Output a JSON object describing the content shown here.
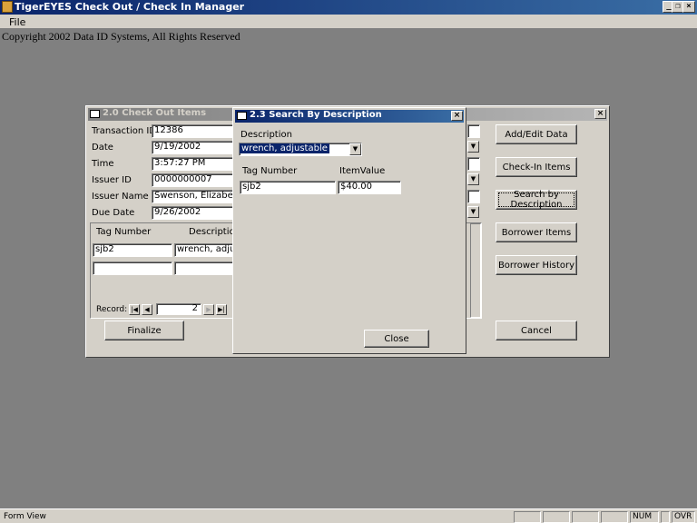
{
  "app": {
    "title": "TigerEYES Check Out / Check In Manager",
    "menu": [
      "File"
    ],
    "copyright": "Copyright 2002 Data ID Systems, All Rights Reserved",
    "window_controls": {
      "minimize": "_",
      "restore": "❐",
      "close": "×"
    }
  },
  "checkout": {
    "title": "2.0  Check Out Items",
    "fields": {
      "transaction_id": {
        "label": "Transaction ID",
        "value": "12386"
      },
      "date": {
        "label": "Date",
        "value": "9/19/2002"
      },
      "time": {
        "label": "Time",
        "value": "3:57:27 PM"
      },
      "issuer_id": {
        "label": "Issuer ID",
        "value": "0000000007"
      },
      "issuer_name": {
        "label": "Issuer Name",
        "value": "Swenson, Elizabeth"
      },
      "due_date": {
        "label": "Due Date",
        "value": "9/26/2002"
      }
    },
    "subform": {
      "headers": {
        "tag_number": "Tag Number",
        "description": "Description"
      },
      "rows": [
        {
          "tag_number": "sjb2",
          "description": "wrench, adjustab"
        },
        {
          "tag_number": "",
          "description": ""
        }
      ],
      "record_label": "Record:",
      "record_number": "2"
    },
    "finalize_label": "Finalize",
    "buttons": {
      "add_edit": "Add/Edit Data",
      "check_in": "Check-In Items",
      "search_desc": "Search by Description",
      "borrower_items": "Borrower Items",
      "borrower_history": "Borrower History",
      "cancel": "Cancel"
    }
  },
  "search": {
    "title": "2.3  Search By Description",
    "description_label": "Description",
    "description_value": "wrench, adjustable",
    "headers": {
      "tag_number": "Tag Number",
      "item_value": "ItemValue"
    },
    "row": {
      "tag_number": "sjb2",
      "item_value": "$40.00"
    },
    "close_label": "Close"
  },
  "statusbar": {
    "left": "Form View",
    "num": "NUM",
    "ovr": "OVR"
  }
}
